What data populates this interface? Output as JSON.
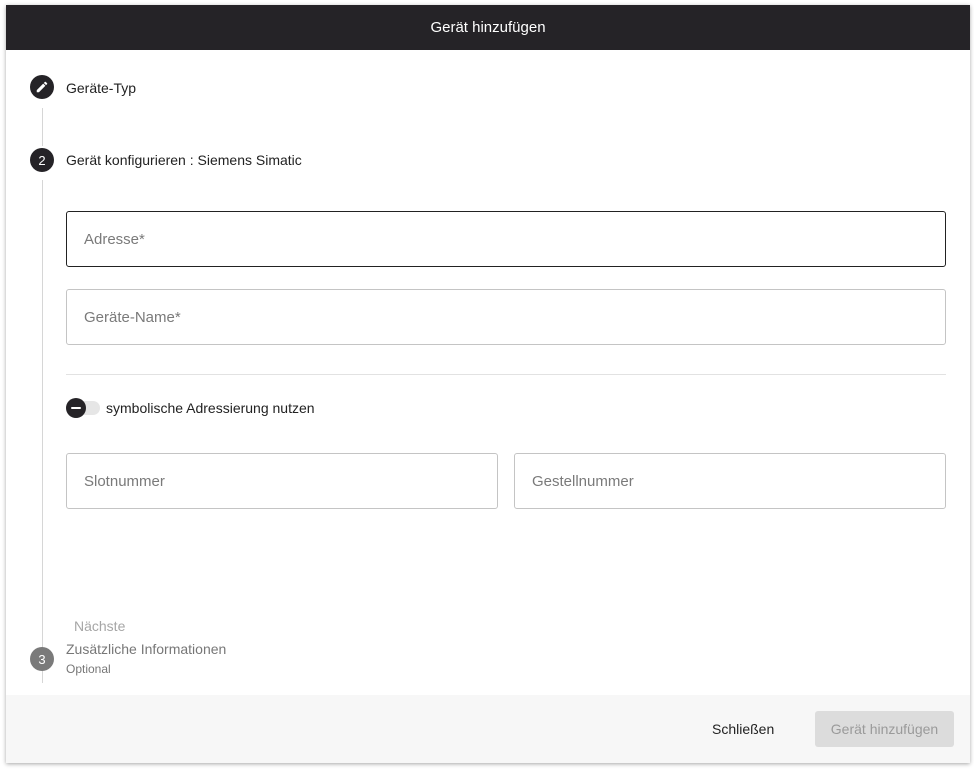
{
  "dialog": {
    "title": "Gerät hinzufügen"
  },
  "steps": [
    {
      "label": "Geräte-Typ",
      "icon": "pencil-icon",
      "state": "done"
    },
    {
      "number": "2",
      "label": "Gerät konfigurieren : Siemens Simatic",
      "state": "active"
    },
    {
      "number": "3",
      "label": "Zusätzliche Informationen",
      "sublabel": "Optional",
      "state": "inactive"
    }
  ],
  "form": {
    "address": {
      "placeholder": "Adresse*",
      "value": ""
    },
    "device_name": {
      "placeholder": "Geräte-Name*",
      "value": ""
    },
    "symbolic_toggle": {
      "label": "symbolische Adressierung nutzen",
      "checked": false
    },
    "slot_number": {
      "placeholder": "Slotnummer",
      "value": ""
    },
    "rack_number": {
      "placeholder": "Gestellnummer",
      "value": ""
    },
    "next_label": "Nächste"
  },
  "footer": {
    "close_label": "Schließen",
    "add_label": "Gerät hinzufügen"
  },
  "colors": {
    "titlebar": "#252327",
    "step_active": "#252327",
    "step_inactive": "#7a7a7a",
    "footer_bg": "#f7f7f7",
    "disabled_button": "#dcdcdc"
  }
}
